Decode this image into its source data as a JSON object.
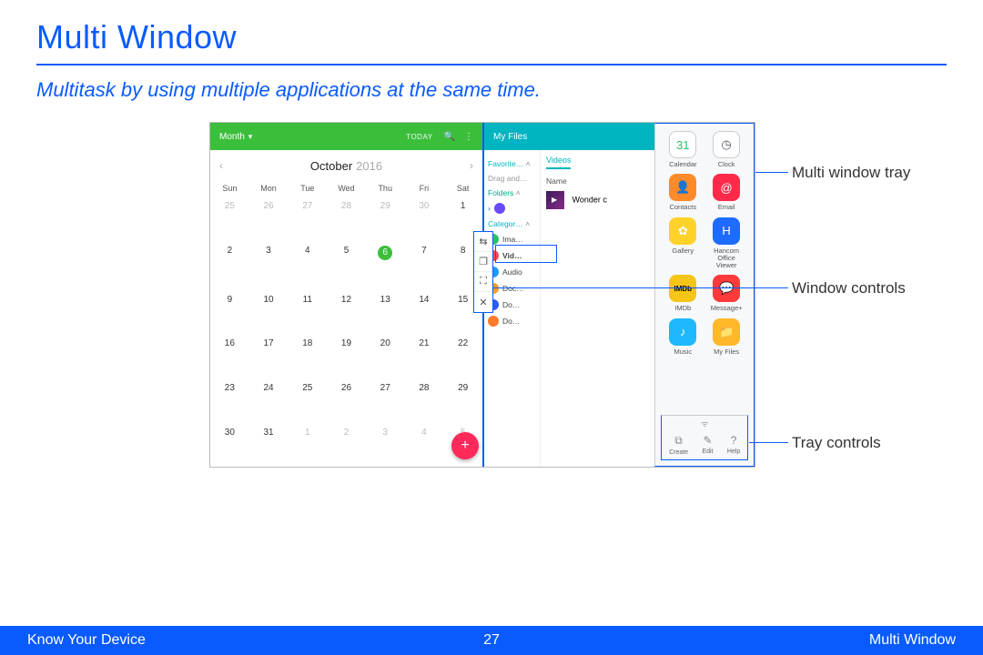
{
  "title": "Multi Window",
  "subtitle": "Multitask by using multiple applications at the same time.",
  "callouts": {
    "tray": "Multi window tray",
    "controls": "Window controls",
    "tray_controls": "Tray controls"
  },
  "calendar": {
    "view_label": "Month",
    "today_label": "TODAY",
    "month": "October",
    "year": "2016",
    "dow": [
      "Sun",
      "Mon",
      "Tue",
      "Wed",
      "Thu",
      "Fri",
      "Sat"
    ],
    "cells": [
      {
        "n": "25",
        "dim": true
      },
      {
        "n": "26",
        "dim": true
      },
      {
        "n": "27",
        "dim": true
      },
      {
        "n": "28",
        "dim": true
      },
      {
        "n": "29",
        "dim": true
      },
      {
        "n": "30",
        "dim": true
      },
      {
        "n": "1"
      },
      {
        "n": "2"
      },
      {
        "n": "3"
      },
      {
        "n": "4"
      },
      {
        "n": "5"
      },
      {
        "n": "6",
        "today": true
      },
      {
        "n": "7"
      },
      {
        "n": "8"
      },
      {
        "n": "9"
      },
      {
        "n": "10"
      },
      {
        "n": "11"
      },
      {
        "n": "12"
      },
      {
        "n": "13"
      },
      {
        "n": "14"
      },
      {
        "n": "15"
      },
      {
        "n": "16"
      },
      {
        "n": "17"
      },
      {
        "n": "18"
      },
      {
        "n": "19"
      },
      {
        "n": "20"
      },
      {
        "n": "21"
      },
      {
        "n": "22"
      },
      {
        "n": "23"
      },
      {
        "n": "24"
      },
      {
        "n": "25"
      },
      {
        "n": "26"
      },
      {
        "n": "27"
      },
      {
        "n": "28"
      },
      {
        "n": "29"
      },
      {
        "n": "30"
      },
      {
        "n": "31"
      },
      {
        "n": "1",
        "dim": true
      },
      {
        "n": "2",
        "dim": true
      },
      {
        "n": "3",
        "dim": true
      },
      {
        "n": "4",
        "dim": true
      },
      {
        "n": "5",
        "dim": true
      }
    ]
  },
  "files": {
    "title": "My Files",
    "left": {
      "group1": "Favorite…",
      "drag": "Drag and…",
      "group2": "Folders",
      "group3": "Categor…",
      "items": [
        {
          "label": "Ima…",
          "color": "#2bbf6a"
        },
        {
          "label": "Vid…",
          "color": "#ff4a5a",
          "boxed": true
        },
        {
          "label": "Audio",
          "color": "#1e9bff"
        },
        {
          "label": "Doc…",
          "color": "#ff9a2a"
        },
        {
          "label": "Do…",
          "color": "#2a5aff"
        },
        {
          "label": "Do…",
          "color": "#ff7a2a"
        }
      ]
    },
    "right": {
      "tab": "Videos",
      "column": "Name",
      "filename": "Wonder c"
    }
  },
  "tray": {
    "apps": [
      {
        "label": "Calendar",
        "bg": "#fff",
        "fg": "#2bbf6a",
        "text": "31",
        "border": true
      },
      {
        "label": "Clock",
        "bg": "#fff",
        "fg": "#556",
        "text": "◷",
        "border": true
      },
      {
        "label": "Contacts",
        "bg": "#ff8a2a",
        "text": "👤"
      },
      {
        "label": "Email",
        "bg": "#ff2a4a",
        "text": "@"
      },
      {
        "label": "Gallery",
        "bg": "#ffd22a",
        "text": "✿"
      },
      {
        "label": "Hancom Office Viewer",
        "bg": "#1e6bff",
        "text": "H"
      },
      {
        "label": "IMDb",
        "bg": "#f5c518",
        "fg": "#000",
        "text": "IMDb",
        "small": true
      },
      {
        "label": "Message+",
        "bg": "#ff3a3a",
        "text": "💬"
      },
      {
        "label": "Music",
        "bg": "#1eb8ff",
        "text": "♪"
      },
      {
        "label": "My Files",
        "bg": "#ffb82a",
        "text": "📁"
      }
    ],
    "controls": [
      {
        "label": "Create",
        "icon": "⧉"
      },
      {
        "label": "Edit",
        "icon": "✎"
      },
      {
        "label": "Help",
        "icon": "?"
      }
    ]
  },
  "footer": {
    "left": "Know Your Device",
    "page": "27",
    "right": "Multi Window"
  }
}
